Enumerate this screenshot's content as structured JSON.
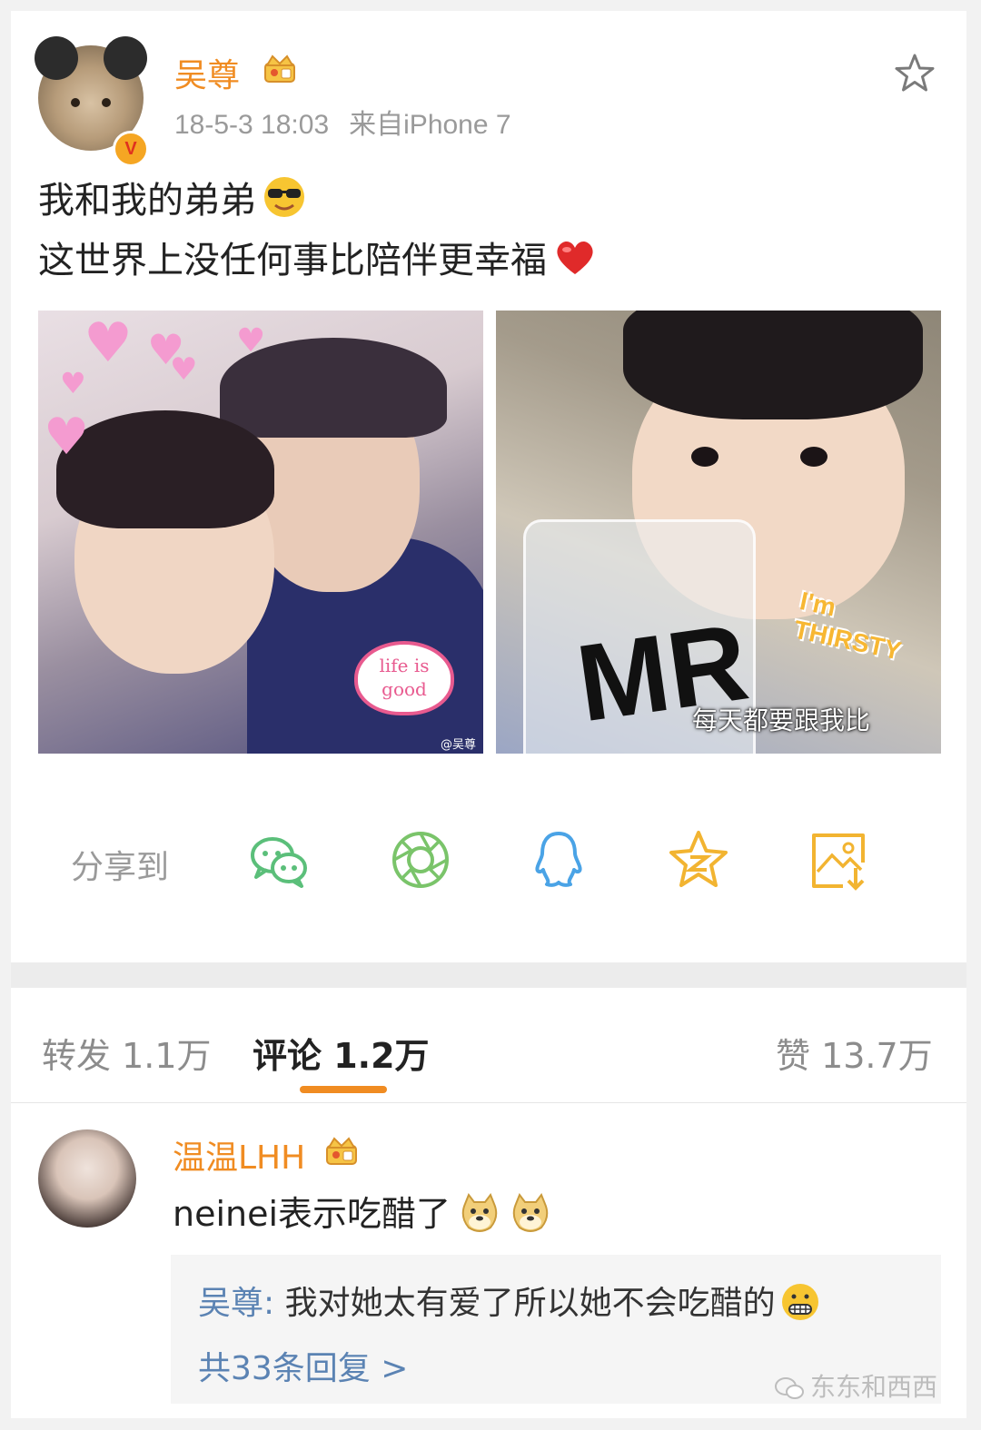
{
  "post": {
    "username": "吴尊",
    "timestamp": "18-5-3 18:03",
    "source": "来自iPhone 7",
    "text_line1": "我和我的弟弟",
    "text_line2": "这世界上没任何事比陪伴更幸福",
    "emoji_line1": "sunglasses-emoji",
    "emoji_line2": "red-heart-emoji",
    "verified_badge": "V",
    "photos": [
      {
        "sticker_text": "life is good",
        "watermark": "@吴尊"
      },
      {
        "sticker_text": "I'm THIRSTY",
        "cup_text": "MR",
        "caption": "每天都要跟我比"
      }
    ]
  },
  "share": {
    "label": "分享到",
    "targets": [
      "wechat-icon",
      "moments-icon",
      "qq-icon",
      "qzone-icon",
      "save-image-icon"
    ]
  },
  "tabs": {
    "repost": "转发 1.1万",
    "comments": "评论 1.2万",
    "likes": "赞 13.7万"
  },
  "comment": {
    "username": "温温LHH",
    "text": "neinei表示吃醋了",
    "emojis": [
      "doge-emoji",
      "doge-emoji"
    ],
    "reply_author": "吴尊:",
    "reply_text": "我对她太有爱了所以她不会吃醋的",
    "reply_emoji": "grimace-emoji",
    "more_replies": "共33条回复 >"
  },
  "watermark": "东东和西西",
  "colors": {
    "accent_orange": "#f08c22",
    "link_blue": "#5b83b3",
    "muted_gray": "#9a9a9a"
  }
}
